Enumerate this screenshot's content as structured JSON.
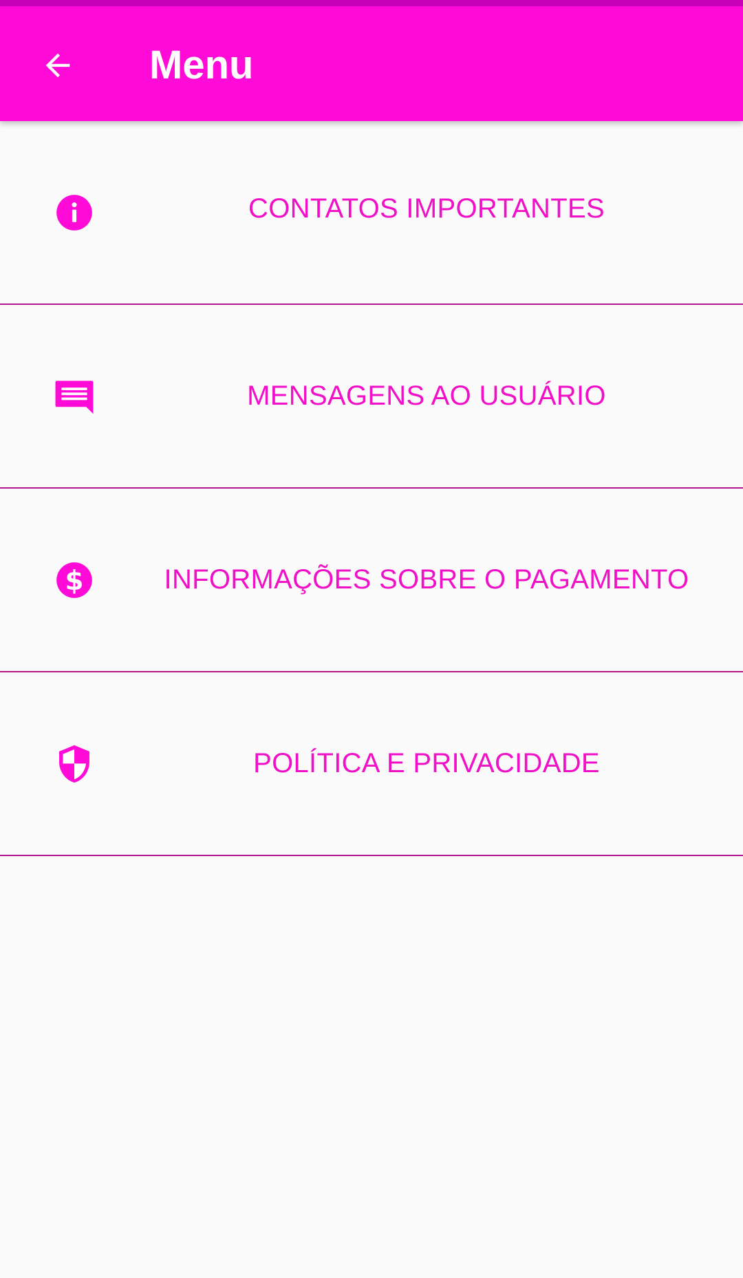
{
  "colors": {
    "app_bar": "#ff0ad6",
    "status_strip": "#c800b8",
    "accent_text": "#f010c8",
    "divider": "#b0168f",
    "background": "#fafafa"
  },
  "header": {
    "back_icon": "arrow-back-icon",
    "title": "Menu"
  },
  "menu": {
    "items": [
      {
        "icon": "info-icon",
        "label": "CONTATOS IMPORTANTES"
      },
      {
        "icon": "message-icon",
        "label": "MENSAGENS AO USUÁRIO"
      },
      {
        "icon": "dollar-icon",
        "label": "INFORMAÇÕES SOBRE O PAGAMENTO"
      },
      {
        "icon": "security-shield-icon",
        "label": "POLÍTICA E PRIVACIDADE"
      }
    ]
  }
}
